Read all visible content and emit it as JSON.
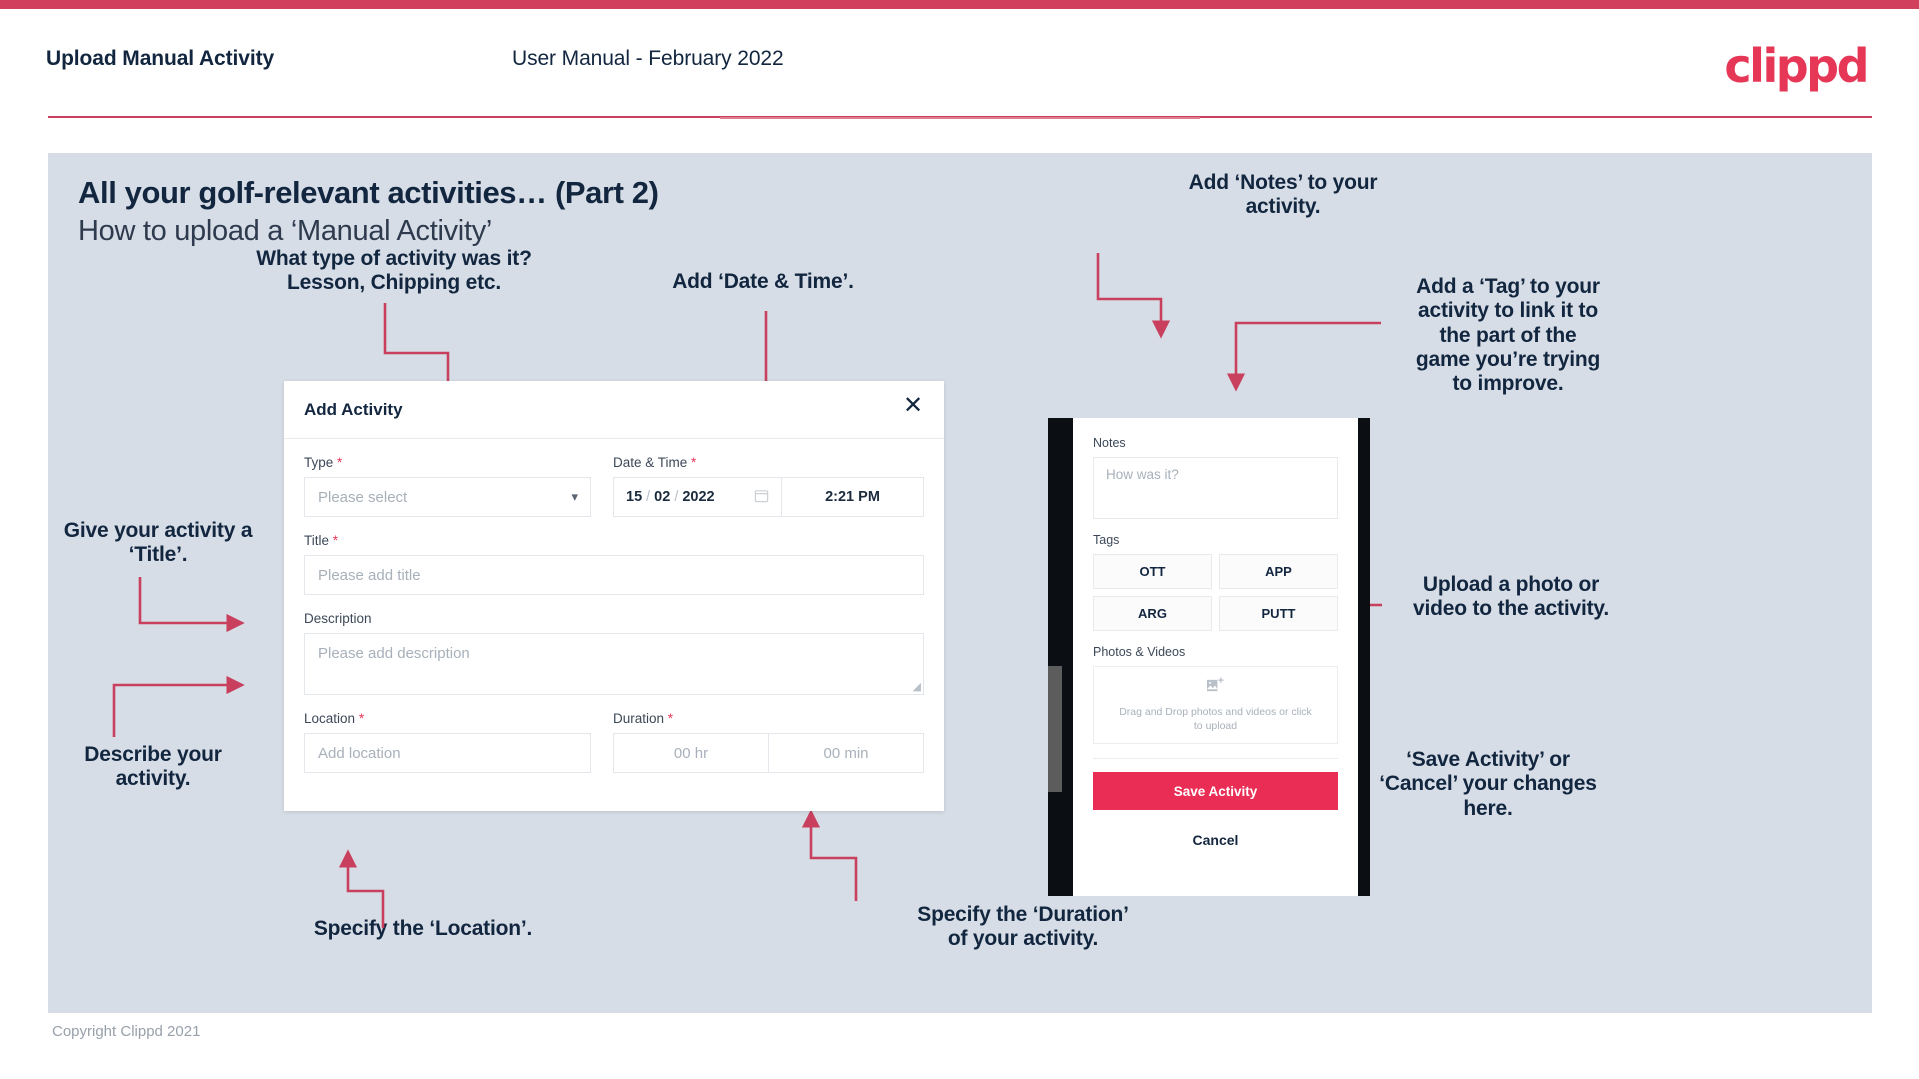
{
  "header": {
    "title": "Upload Manual Activity",
    "subtitle": "User Manual - February 2022",
    "brand": "clippd"
  },
  "slide": {
    "title": "All your golf-relevant activities… (Part 2)",
    "subtitle": "How to upload a ‘Manual Activity’"
  },
  "annotations": {
    "type": "What type of activity was it?\nLesson, Chipping etc.",
    "datetime": "Add ‘Date & Time’.",
    "title": "Give your activity a\n‘Title’.",
    "description": "Describe your\nactivity.",
    "location": "Specify the ‘Location’.",
    "duration": "Specify the ‘Duration’\nof your activity.",
    "notes": "Add ‘Notes’ to your\nactivity.",
    "tags": "Add a ‘Tag’ to your\nactivity to link it to\nthe part of the\ngame you’re trying\nto improve.",
    "photos": "Upload a photo or\nvideo to the activity.",
    "save_cancel": "‘Save Activity’ or\n‘Cancel’ your changes\nhere."
  },
  "dialog": {
    "title": "Add Activity",
    "close_icon": "close-icon",
    "fields": {
      "type": {
        "label": "Type",
        "required": "*",
        "placeholder": "Please select",
        "caret_icon": "chevron-down-icon"
      },
      "datetime": {
        "label": "Date & Time",
        "required": "*",
        "day": "15",
        "month": "02",
        "year": "2022",
        "sep": "/",
        "calendar_icon": "calendar-icon",
        "time": "2:21 PM"
      },
      "title": {
        "label": "Title",
        "required": "*",
        "placeholder": "Please add title"
      },
      "description": {
        "label": "Description",
        "required": "",
        "placeholder": "Please add description"
      },
      "location": {
        "label": "Location",
        "required": "*",
        "placeholder": "Add location"
      },
      "duration": {
        "label": "Duration",
        "required": "*",
        "hours_placeholder": "00 hr",
        "minutes_placeholder": "00 min"
      }
    }
  },
  "phone": {
    "notes": {
      "label": "Notes",
      "placeholder": "How was it?"
    },
    "tags": {
      "label": "Tags",
      "items": [
        "OTT",
        "APP",
        "ARG",
        "PUTT"
      ]
    },
    "photos": {
      "label": "Photos & Videos",
      "icon": "add-image-icon",
      "dropzone_text": "Drag and Drop photos and videos or click to upload"
    },
    "save_label": "Save Activity",
    "cancel_label": "Cancel"
  },
  "footer": {
    "copyright": "Copyright Clippd 2021"
  },
  "colors": {
    "accent": "#e63757",
    "arrow": "#c9405f",
    "slide_bg": "#d6dde6",
    "save_button": "#ea2d55",
    "text_dark": "#12263f"
  }
}
